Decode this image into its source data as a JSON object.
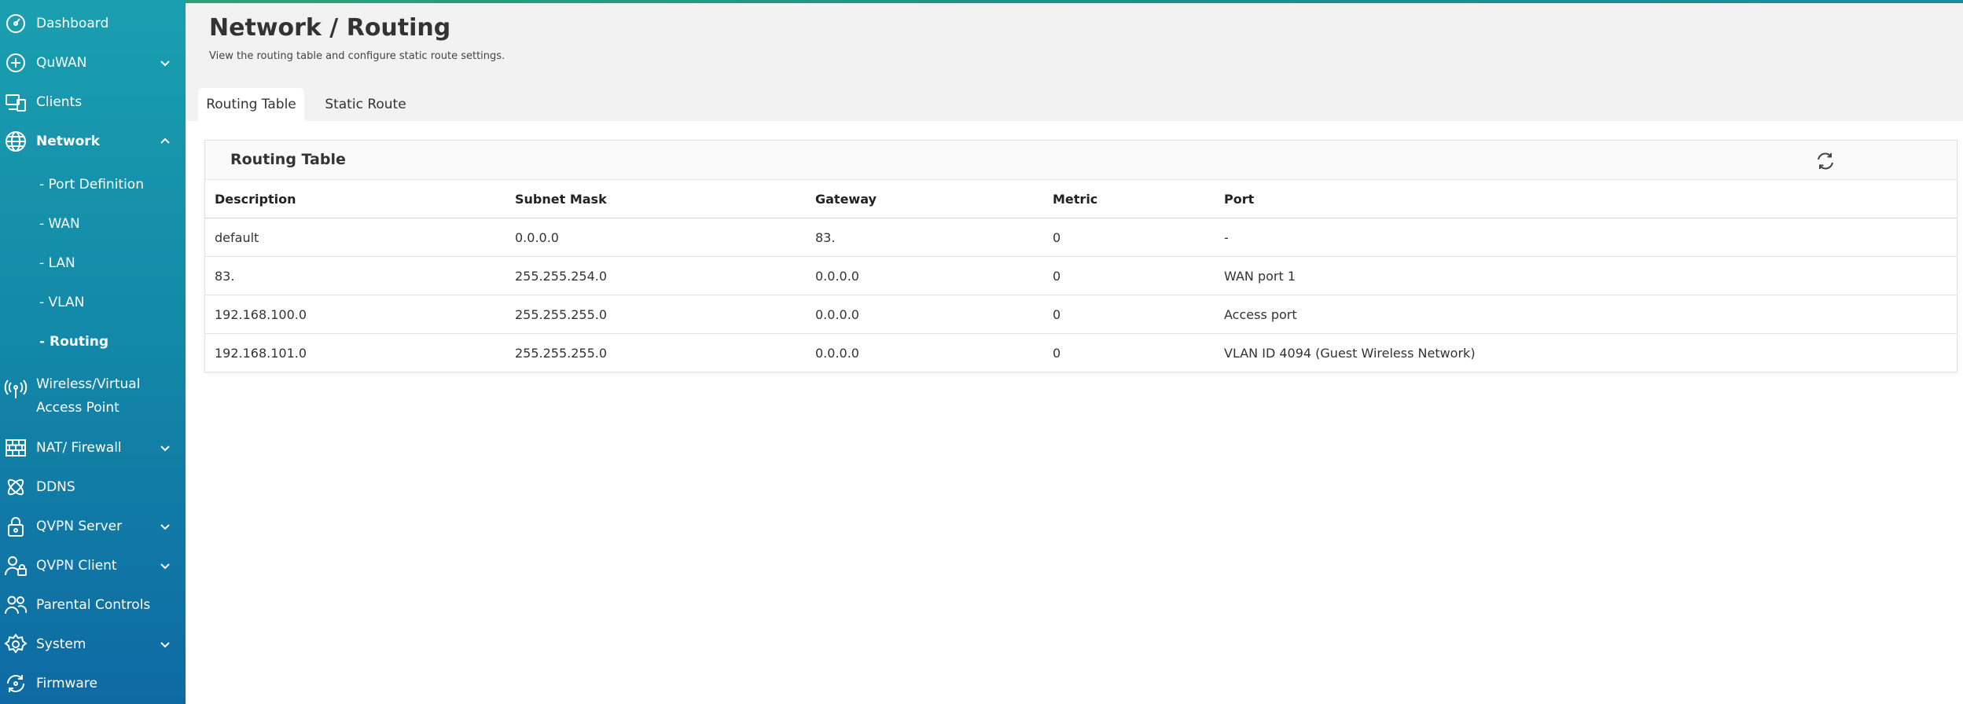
{
  "sidebar": {
    "items": [
      {
        "label": "Dashboard",
        "icon": "dashboard-icon"
      },
      {
        "label": "QuWAN",
        "icon": "quwan-icon"
      },
      {
        "label": "Clients",
        "icon": "clients-icon"
      },
      {
        "label": "Network",
        "icon": "globe-icon"
      },
      {
        "label": "Wireless/Virtual Access Point",
        "icon": "wireless-icon"
      },
      {
        "label": "NAT/ Firewall",
        "icon": "firewall-icon"
      },
      {
        "label": "DDNS",
        "icon": "ddns-icon"
      },
      {
        "label": "QVPN Server",
        "icon": "lock-icon"
      },
      {
        "label": "QVPN Client",
        "icon": "vpn-client-icon"
      },
      {
        "label": "Parental Controls",
        "icon": "users-icon"
      },
      {
        "label": "System",
        "icon": "gear-icon"
      },
      {
        "label": "Firmware",
        "icon": "firmware-icon"
      }
    ],
    "network_sub": [
      "- Port Definition",
      "- WAN",
      "- LAN",
      "- VLAN",
      "- Routing"
    ]
  },
  "header": {
    "title": "Network / Routing",
    "subtitle": "View the routing table and configure static route settings."
  },
  "tabs": [
    "Routing Table",
    "Static Route"
  ],
  "panel": {
    "title": "Routing Table",
    "columns": [
      "Description",
      "Subnet Mask",
      "Gateway",
      "Metric",
      "Port"
    ],
    "rows": [
      [
        "default",
        "0.0.0.0",
        "83.",
        "0",
        "-"
      ],
      [
        "83.",
        "255.255.254.0",
        "0.0.0.0",
        "0",
        "WAN port 1"
      ],
      [
        "192.168.100.0",
        "255.255.255.0",
        "0.0.0.0",
        "0",
        "Access port"
      ],
      [
        "192.168.101.0",
        "255.255.255.0",
        "0.0.0.0",
        "0",
        "VLAN ID 4094 (Guest Wireless Network)"
      ]
    ]
  },
  "colors": {
    "sidebar_top": "#1a9fb0",
    "sidebar_bottom": "#0e6aa3",
    "accent_line": "#2aa37a",
    "header_bg": "#f2f2f2"
  }
}
